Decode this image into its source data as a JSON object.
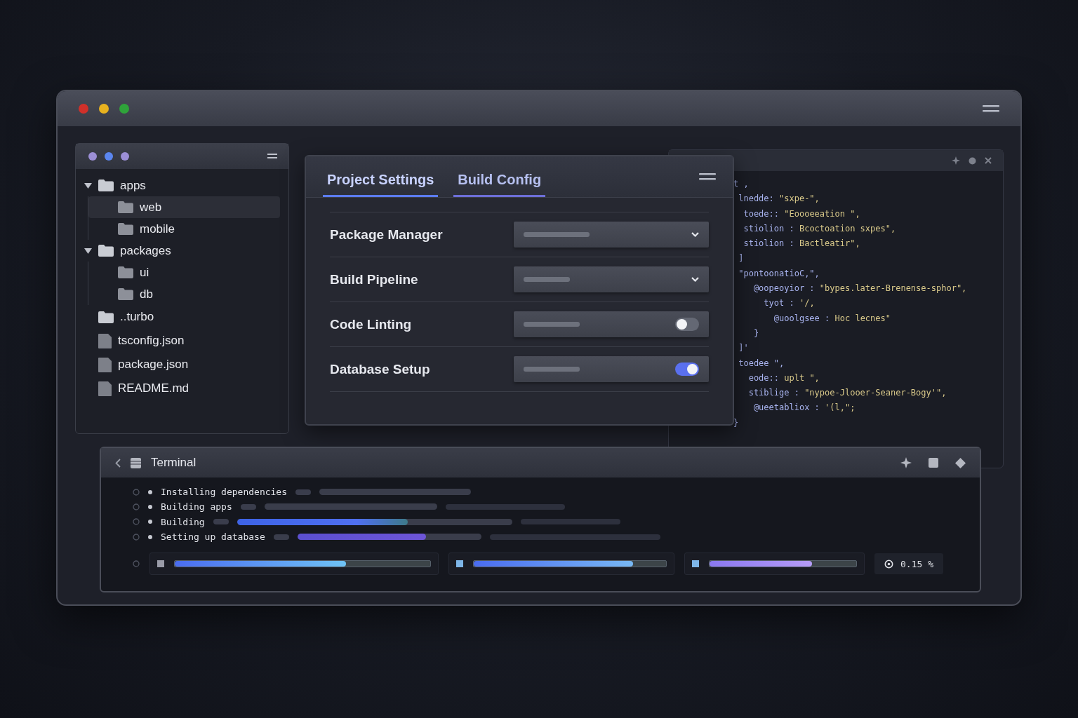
{
  "window": {
    "traffic_lights": [
      {
        "color": "#d0302a"
      },
      {
        "color": "#e8b21f"
      },
      {
        "color": "#2fa33a"
      }
    ]
  },
  "explorer": {
    "dots": [
      {
        "color": "#9c8fd6"
      },
      {
        "color": "#5b86f0"
      },
      {
        "color": "#9c8fd6"
      }
    ],
    "tree": [
      {
        "name": "apps",
        "kind": "folder",
        "expanded": true,
        "selected": false,
        "children": [
          {
            "name": "web",
            "kind": "folder",
            "selected": true
          },
          {
            "name": "mobile",
            "kind": "folder",
            "selected": false
          }
        ]
      },
      {
        "name": "packages",
        "kind": "folder",
        "expanded": true,
        "selected": false,
        "children": [
          {
            "name": "ui",
            "kind": "folder",
            "selected": false
          },
          {
            "name": "db",
            "kind": "folder",
            "selected": false
          }
        ]
      },
      {
        "name": "..turbo",
        "kind": "folder",
        "selected": false
      },
      {
        "name": "tsconfig.json",
        "kind": "file",
        "selected": false
      },
      {
        "name": "package.json",
        "kind": "file",
        "selected": false
      },
      {
        "name": "README.md",
        "kind": "file",
        "selected": false
      }
    ]
  },
  "settings": {
    "tabs": [
      {
        "label": "Project Settings",
        "selected": true
      },
      {
        "label": "Build Config",
        "selected": false
      }
    ],
    "rows": [
      {
        "label": "Package Manager",
        "kind": "dropdown"
      },
      {
        "label": "Build Pipeline",
        "kind": "dropdown"
      },
      {
        "label": "Code Linting",
        "kind": "toggle",
        "on": false
      },
      {
        "label": "Database Setup",
        "kind": "toggle",
        "on": true
      }
    ]
  },
  "code": {
    "lines": [
      {
        "k": "t ,"
      },
      {
        "k": " lnedde:",
        "v": " \"sxpe-\","
      },
      {
        "k": "  toede::",
        "v": " \"Eoooeeation \","
      },
      {
        "k": "  stiolion :",
        "v": " Bcoctoation sxpes\","
      },
      {
        "k": "  stiolion :",
        "v": " Bactleatir\","
      },
      {
        "k": " ]"
      },
      {
        "k": " \"pontoonatioC,\","
      },
      {
        "k": "    @oopeoyior :",
        "v": " \"bypes.later-Brenense-sphor\","
      },
      {
        "k": "      tyot :",
        "v": " '/,"
      },
      {
        "k": "        @uoolgsee :",
        "v": " Hoc lecnes\""
      },
      {
        "k": "    }"
      },
      {
        "k": " ]'"
      },
      {
        "k": " toedee \","
      },
      {
        "k": "   eode::",
        "v": " uplt \","
      },
      {
        "k": "   stiblige :",
        "v": " \"nypoe-Jlooer-Seaner-Bogy'\","
      },
      {
        "k": "    @ueetabliox :",
        "v": " '(l,\";"
      },
      {
        "k": "}"
      }
    ]
  },
  "terminal": {
    "title": "Terminal",
    "tasks": [
      {
        "label": "Installing dependencies"
      },
      {
        "label": "Building apps"
      },
      {
        "label": "Building",
        "level": 0.62
      },
      {
        "label": "Setting up database",
        "level": 0.7
      }
    ],
    "meters": [
      {
        "level": 0.67
      },
      {
        "level": 0.83
      },
      {
        "level": 0.7
      }
    ],
    "percent": "0.15 %"
  }
}
